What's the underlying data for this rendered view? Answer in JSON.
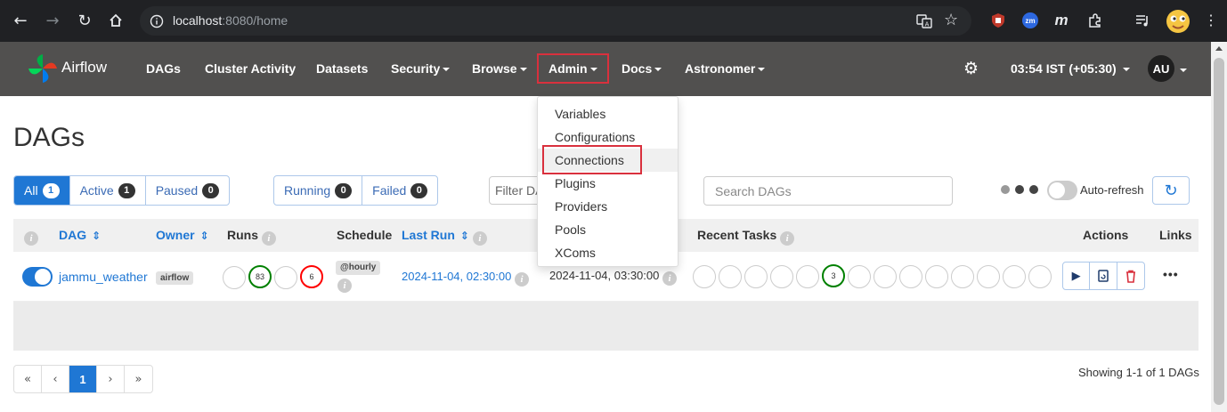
{
  "browser": {
    "url_host": "localhost",
    "url_rest": ":8080/home",
    "extensions": [
      "translate-icon",
      "star-icon",
      "ublock-icon",
      "zoom-icon",
      "m-icon",
      "puzzle-icon",
      "media-icon",
      "profile-emoji-icon",
      "kebab-menu-icon"
    ],
    "zm_label": "zm",
    "m_label": "m"
  },
  "navbar": {
    "brand": "Airflow",
    "items": [
      {
        "label": "DAGs"
      },
      {
        "label": "Cluster Activity"
      },
      {
        "label": "Datasets"
      },
      {
        "label": "Security"
      },
      {
        "label": "Browse"
      },
      {
        "label": "Admin"
      },
      {
        "label": "Docs"
      },
      {
        "label": "Astronomer"
      }
    ],
    "time": "03:54 IST (+05:30)",
    "avatar": "AU"
  },
  "admin_menu": {
    "items": [
      "Variables",
      "Configurations",
      "Connections",
      "Plugins",
      "Providers",
      "Pools",
      "XComs"
    ]
  },
  "page": {
    "title": "DAGs",
    "status_filters": [
      {
        "label": "All",
        "count": "1"
      },
      {
        "label": "Active",
        "count": "1"
      },
      {
        "label": "Paused",
        "count": "0"
      }
    ],
    "run_filters": [
      {
        "label": "Running",
        "count": "0"
      },
      {
        "label": "Failed",
        "count": "0"
      }
    ],
    "filter_placeholder": "Filter DAGs by tag",
    "search_placeholder": "Search DAGs",
    "auto_refresh": "Auto-refresh"
  },
  "table": {
    "headers": {
      "dag": "DAG",
      "owner": "Owner",
      "runs": "Runs",
      "schedule": "Schedule",
      "last_run": "Last Run",
      "recent_tasks": "Recent Tasks",
      "actions": "Actions",
      "links": "Links"
    },
    "rows": [
      {
        "dag_id": "jammu_weather",
        "owner": "airflow",
        "runs_success": "83",
        "runs_failed": "6",
        "schedule": "@hourly",
        "last_run": "2024-11-04, 02:30:00",
        "next_run": "2024-11-04, 03:30:00",
        "recent_success": "3"
      }
    ]
  },
  "pagination": {
    "pages": [
      "«",
      "‹",
      "1",
      "›",
      "»"
    ],
    "showing": "Showing 1-1 of 1 DAGs"
  },
  "colors": {
    "navbar": "#51504f",
    "primary": "#1f77d4",
    "highlight": "#d9303d",
    "success": "#008000",
    "failed": "#ff0000"
  }
}
